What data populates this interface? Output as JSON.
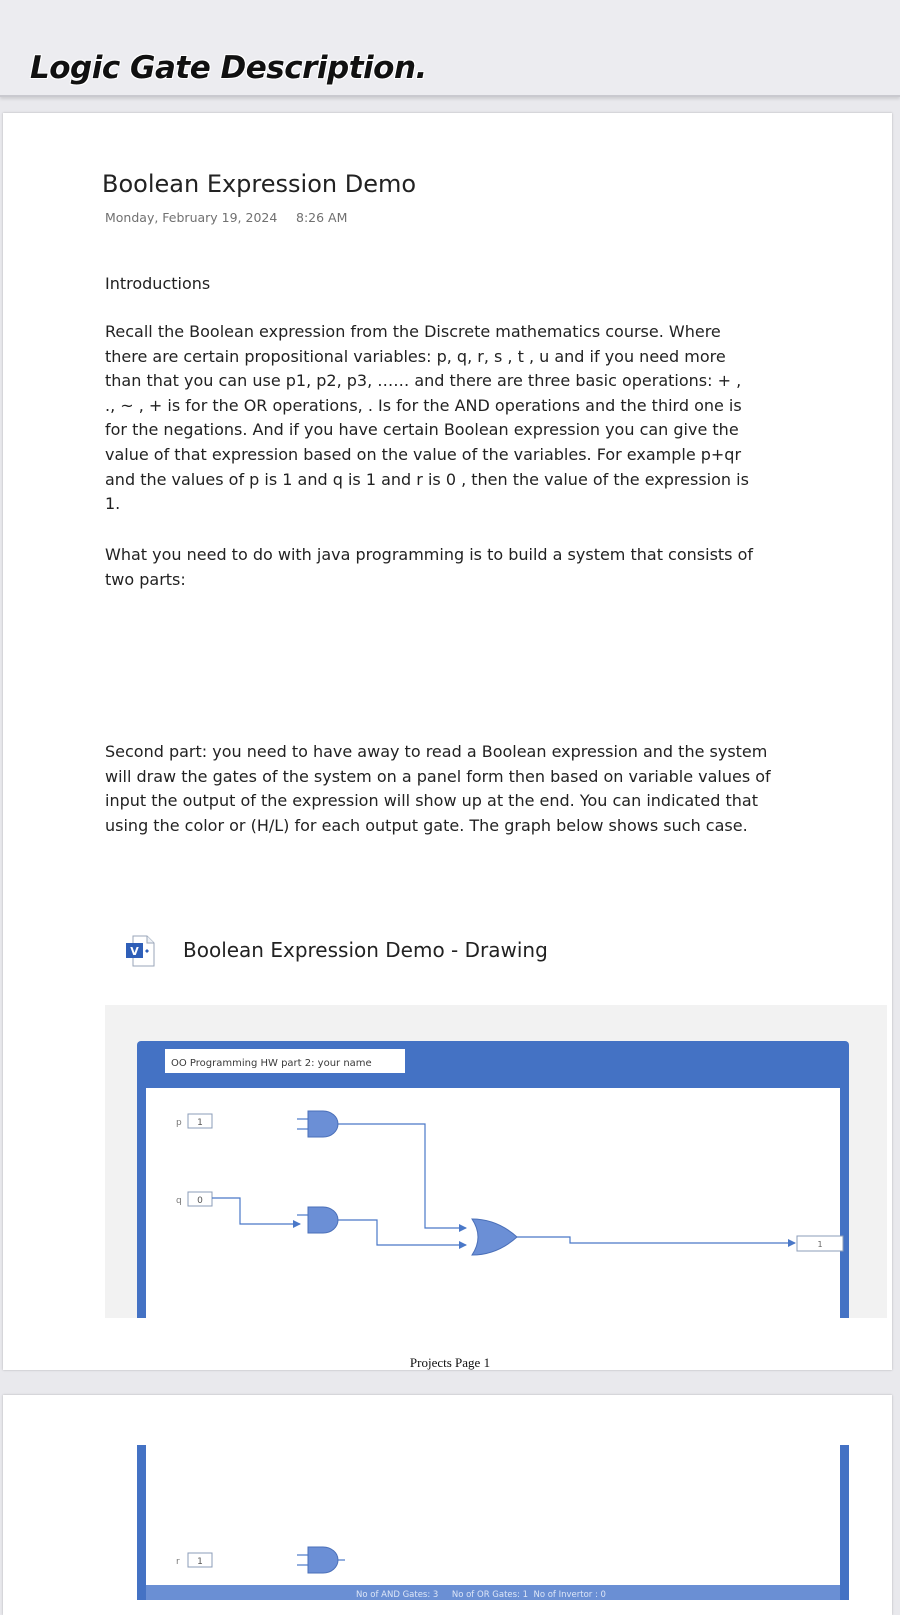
{
  "banner": {
    "title": "Logic Gate Description."
  },
  "note": {
    "title": "Boolean Expression Demo",
    "date": "Monday, February 19, 2024",
    "time": "8:26 AM",
    "intro_heading": "Introductions",
    "paragraph1": "Recall the Boolean expression from the Discrete mathematics course. Where there are certain propositional variables: p, q, r, s , t , u  and if you need more than that you can use p1, p2, p3, …… and there are three basic operations: + , ., ~ , + is for the OR operations, . Is for the AND operations and the third one is for the negations. And if you have certain Boolean expression you can give the value of that expression based on the value of the variables. For example p+qr and the values of p is 1 and q is 1 and r is 0 , then the value of the expression is 1.",
    "paragraph2": "What you need to do with java programming is to build a system that consists of two parts:",
    "paragraph3": "Second part: you need to have away to read a Boolean expression and the system will draw the gates of the system on a panel form then based on variable values of input the output of the expression will show up at the end. You can indicated that using the color or (H/L)  for each output gate. The graph below shows such case."
  },
  "embed": {
    "icon_letter": "V",
    "title": "Boolean Expression Demo - Drawing"
  },
  "drawing": {
    "header_label": "OO Programming  HW part 2: your name",
    "inputs": [
      {
        "name": "p",
        "value": "1"
      },
      {
        "name": "q",
        "value": "0"
      },
      {
        "name": "r",
        "value": "1"
      }
    ],
    "output_value": "1",
    "status_bar": "No of AND Gates: 3     No of OR Gates: 1  No of Invertor : 0",
    "colors": {
      "frame": "#4472c4",
      "gate_fill": "#6b8fd6",
      "wire": "#4a78c8"
    }
  },
  "page": {
    "footer": "Projects Page 1"
  }
}
